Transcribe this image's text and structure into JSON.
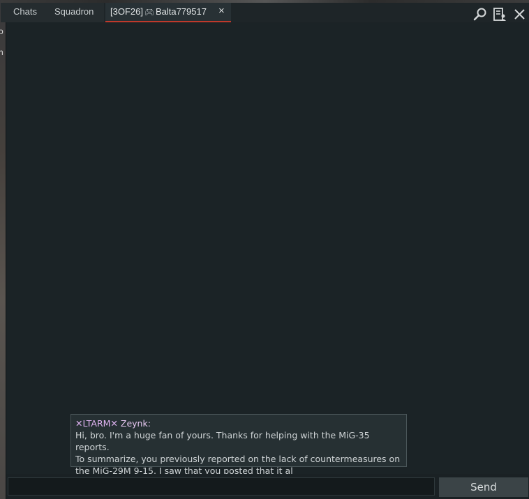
{
  "background": {
    "left_text": [
      "o",
      "h"
    ]
  },
  "tabs": {
    "chats": "Chats",
    "squadron": "Squadron",
    "active": {
      "prefix": "[3OF26]",
      "name": "Balta779517",
      "close": "×"
    }
  },
  "toolbar": {
    "search": "search-icon",
    "contacts": "contacts-icon",
    "close": "close-icon"
  },
  "message_preview": {
    "sender_tag": "LTARM",
    "sender_name": "Zeynk",
    "line1": "Hi, bro. I'm a huge fan of yours. Thanks for helping with the MiG-35 reports.",
    "line2": "To summarize, you previously reported on the lack of countermeasures on",
    "line3": "the MiG-29M 9-15. I saw that you posted that it al"
  },
  "input": {
    "value": "",
    "placeholder": ""
  },
  "send_label": "Send",
  "colors": {
    "accent_underline": "#c0392b",
    "sender_color": "#e0b3f2",
    "panel_bg": "#1b2326"
  }
}
